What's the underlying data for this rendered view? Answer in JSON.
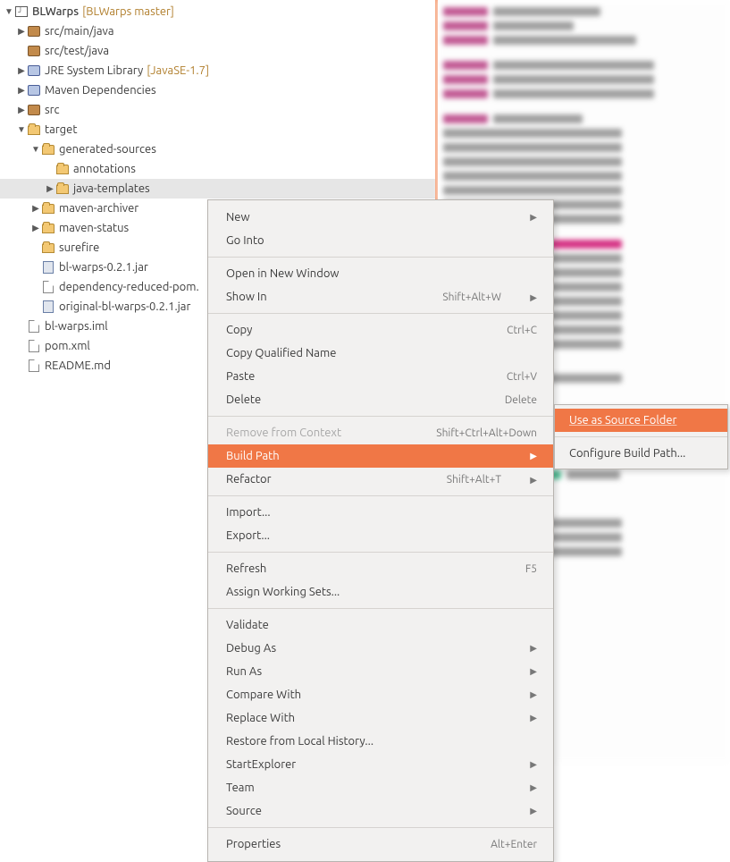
{
  "project": {
    "name": "BLWarps",
    "branch": "[BLWarps master]"
  },
  "tree": {
    "srcmain": "src/main/java",
    "srctest": "src/test/java",
    "jre": "JRE System Library",
    "jre_ver": "[JavaSE-1.7]",
    "maven_dep": "Maven Dependencies",
    "src": "src",
    "target": "target",
    "gensrc": "generated-sources",
    "annotations": "annotations",
    "javatemplates": "java-templates",
    "maven_archiver": "maven-archiver",
    "maven_status": "maven-status",
    "surefire": "surefire",
    "jar1": "bl-warps-0.2.1.jar",
    "deppom": "dependency-reduced-pom.",
    "origjar": "original-bl-warps-0.2.1.jar",
    "iml": "bl-warps.iml",
    "pom": "pom.xml",
    "readme": "README.md"
  },
  "menu": {
    "new": "New",
    "go_into": "Go Into",
    "open_new_window": "Open in New Window",
    "show_in": "Show In",
    "show_in_accel": "Shift+Alt+W",
    "copy": "Copy",
    "copy_accel": "Ctrl+C",
    "copy_qual": "Copy Qualified Name",
    "paste": "Paste",
    "paste_accel": "Ctrl+V",
    "delete": "Delete",
    "delete_accel": "Delete",
    "remove_ctx": "Remove from Context",
    "remove_ctx_accel": "Shift+Ctrl+Alt+Down",
    "build_path": "Build Path",
    "refactor": "Refactor",
    "refactor_accel": "Shift+Alt+T",
    "import": "Import...",
    "export": "Export...",
    "refresh": "Refresh",
    "refresh_accel": "F5",
    "assign_ws": "Assign Working Sets...",
    "validate": "Validate",
    "debug_as": "Debug As",
    "run_as": "Run As",
    "compare_with": "Compare With",
    "replace_with": "Replace With",
    "restore_local": "Restore from Local History...",
    "start_explorer": "StartExplorer",
    "team": "Team",
    "source": "Source",
    "properties": "Properties",
    "properties_accel": "Alt+Enter"
  },
  "submenu": {
    "use_as_source": "Use as Source Folder",
    "configure": "Configure Build Path..."
  }
}
